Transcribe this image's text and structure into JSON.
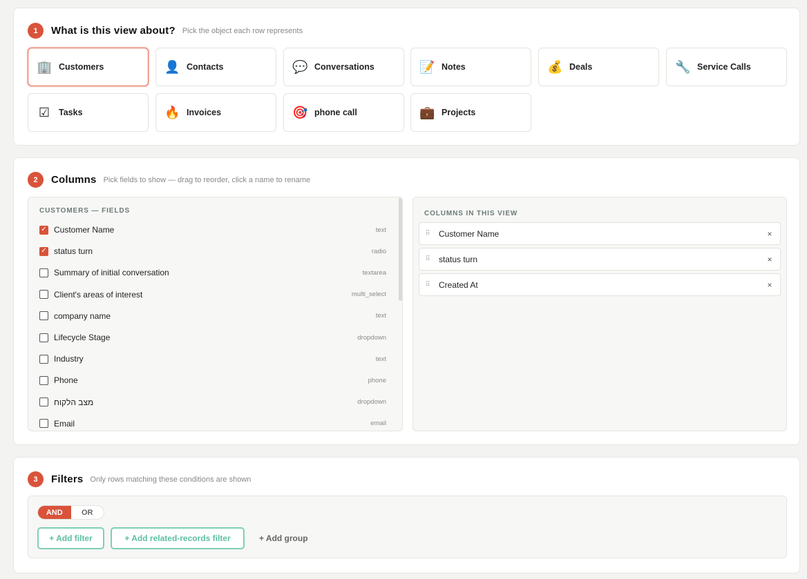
{
  "section1": {
    "number": "1",
    "title": "What is this view about?",
    "subtitle": "Pick the object each row represents",
    "objects": [
      {
        "label": "Customers",
        "icon": "🏢",
        "icon_name": "office-building-icon",
        "selected": true
      },
      {
        "label": "Contacts",
        "icon": "👤",
        "icon_name": "person-icon",
        "selected": false
      },
      {
        "label": "Conversations",
        "icon": "💬",
        "icon_name": "speech-bubble-icon",
        "selected": false
      },
      {
        "label": "Notes",
        "icon": "📝",
        "icon_name": "memo-icon",
        "selected": false
      },
      {
        "label": "Deals",
        "icon": "💰",
        "icon_name": "money-bag-icon",
        "selected": false
      },
      {
        "label": "Service Calls",
        "icon": "🔧",
        "icon_name": "wrench-icon",
        "selected": false
      },
      {
        "label": "Tasks",
        "icon": "☑",
        "icon_name": "checkbox-icon",
        "selected": false
      },
      {
        "label": "Invoices",
        "icon": "🔥",
        "icon_name": "fire-icon",
        "selected": false
      },
      {
        "label": "phone call",
        "icon": "🎯",
        "icon_name": "target-icon",
        "selected": false
      },
      {
        "label": "Projects",
        "icon": "💼",
        "icon_name": "briefcase-icon",
        "selected": false
      }
    ]
  },
  "section2": {
    "number": "2",
    "title": "Columns",
    "subtitle": "Pick fields to show — drag to reorder, click a name to rename",
    "fields_title": "CUSTOMERS — FIELDS",
    "fields": [
      {
        "name": "Customer Name",
        "type": "text",
        "checked": true
      },
      {
        "name": "status turn",
        "type": "radio",
        "checked": true
      },
      {
        "name": "Summary of initial conversation",
        "type": "textarea",
        "checked": false
      },
      {
        "name": "Client's areas of interest",
        "type": "multi_select",
        "checked": false
      },
      {
        "name": "company name",
        "type": "text",
        "checked": false
      },
      {
        "name": "Lifecycle Stage",
        "type": "dropdown",
        "checked": false
      },
      {
        "name": "Industry",
        "type": "text",
        "checked": false
      },
      {
        "name": "Phone",
        "type": "phone",
        "checked": false
      },
      {
        "name": "מצב הלקוח",
        "type": "dropdown",
        "checked": false
      },
      {
        "name": "Email",
        "type": "email",
        "checked": false
      }
    ],
    "view_title": "COLUMNS IN THIS VIEW",
    "columns": [
      "Customer Name",
      "status turn",
      "Created At"
    ],
    "grip_glyph": "⠿",
    "remove_glyph": "×"
  },
  "section3": {
    "number": "3",
    "title": "Filters",
    "subtitle": "Only rows matching these conditions are shown",
    "and_label": "AND",
    "or_label": "OR",
    "add_filter": "+ Add filter",
    "add_related": "+ Add related-records filter",
    "add_group": "+ Add group"
  },
  "colors": {
    "accent": "#d9533a",
    "teal": "#5cbfa2"
  }
}
